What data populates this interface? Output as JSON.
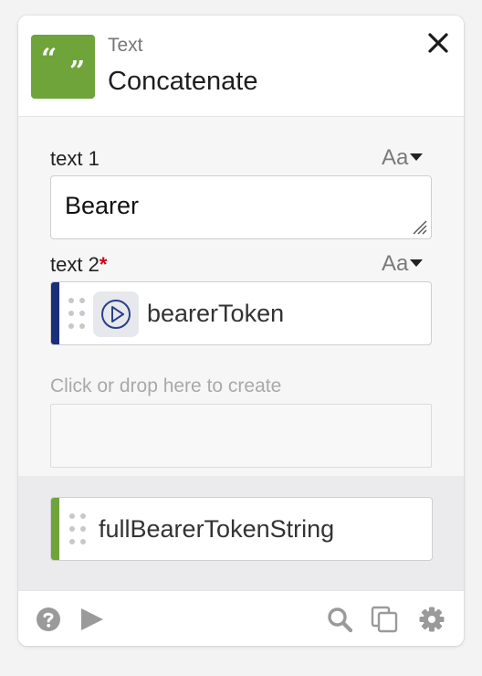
{
  "header": {
    "category": "Text",
    "title": "Concatenate",
    "icon": "quote-marks-icon",
    "icon_color": "#6ea43a",
    "icon_glyph_open": "“",
    "icon_glyph_close": "”"
  },
  "fields": [
    {
      "label": "text 1",
      "required": false,
      "format_toggle": "Aa",
      "value": "Bearer"
    },
    {
      "label": "text 2",
      "required": true,
      "required_marker": "*",
      "format_toggle": "Aa",
      "token": {
        "label": "bearerToken",
        "color": "#1a2f7a",
        "icon": "play-circle-icon"
      }
    }
  ],
  "drop_zone": {
    "hint": "Click or drop here to create"
  },
  "output": {
    "label": "fullBearerTokenString",
    "color": "#6ea43a"
  },
  "footer": {
    "left_icons": [
      "help-icon",
      "play-icon"
    ],
    "right_icons": [
      "search-icon",
      "copy-icon",
      "settings-icon"
    ]
  }
}
